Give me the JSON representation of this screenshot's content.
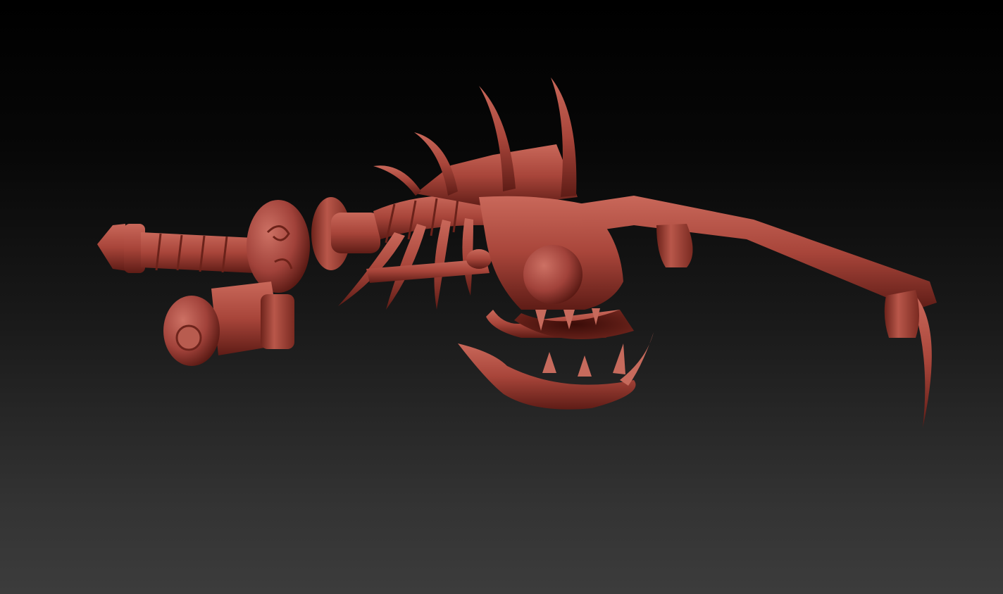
{
  "scene": {
    "subject": "sculpt-model",
    "colors": {
      "clay_base": "#a8453a",
      "clay_dark": "#5e1c16",
      "clay_light": "#c9685a",
      "background_top": "#000000",
      "background_bottom": "#3c3c3c"
    }
  }
}
